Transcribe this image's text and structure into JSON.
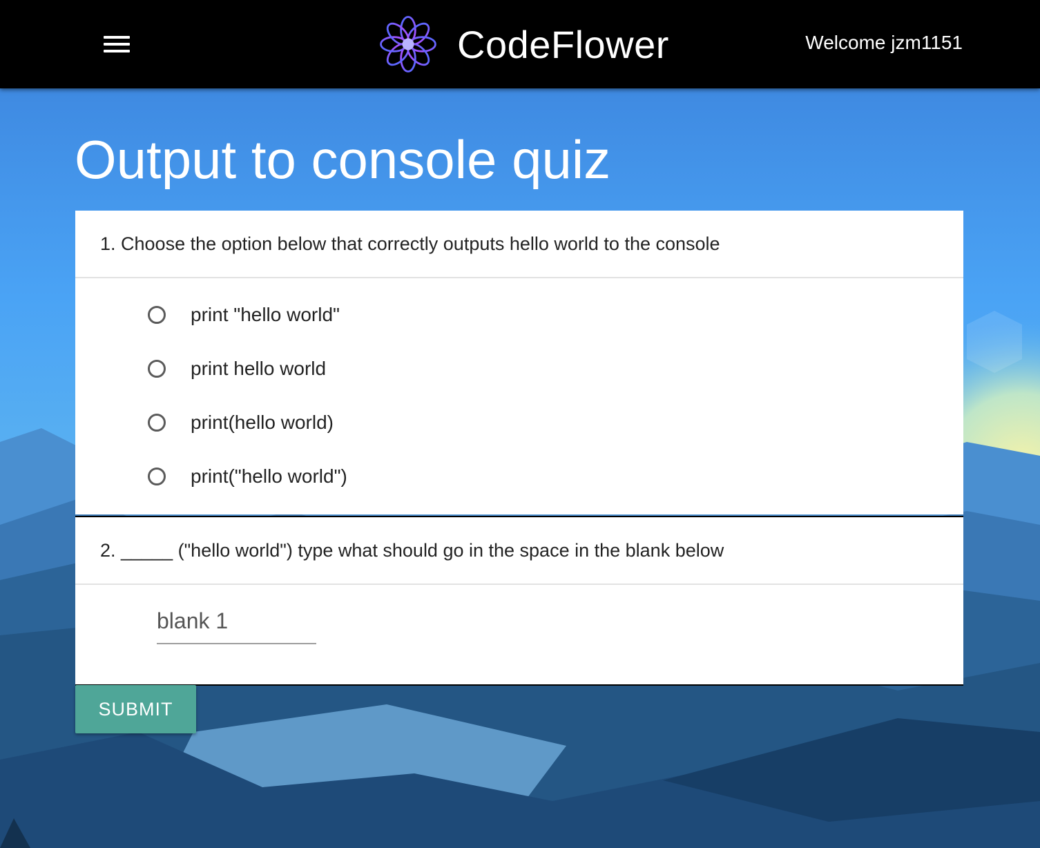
{
  "header": {
    "brand_name": "CodeFlower",
    "welcome_text": "Welcome jzm1151",
    "logo_icon": "flower-logo-icon",
    "menu_icon": "hamburger-menu-icon"
  },
  "quiz": {
    "title": "Output to console quiz",
    "questions": [
      {
        "text": "1. Choose the option below that correctly outputs hello world to the console",
        "type": "radio",
        "options": [
          "print \"hello world\"",
          "print hello world",
          "print(hello world)",
          "print(\"hello world\")"
        ]
      },
      {
        "text": "2. _____ (\"hello world\")  type what should go in the space in the blank below",
        "type": "fill-blank",
        "input_value": "",
        "input_placeholder": "blank 1"
      }
    ],
    "submit_label": "SUBMIT"
  },
  "colors": {
    "navbar": "#000000",
    "accent_button": "#4fa698",
    "sky_top": "#3a7fd9",
    "sky_mid": "#4aa3f5",
    "mountains_dark": "#1e4a78"
  }
}
